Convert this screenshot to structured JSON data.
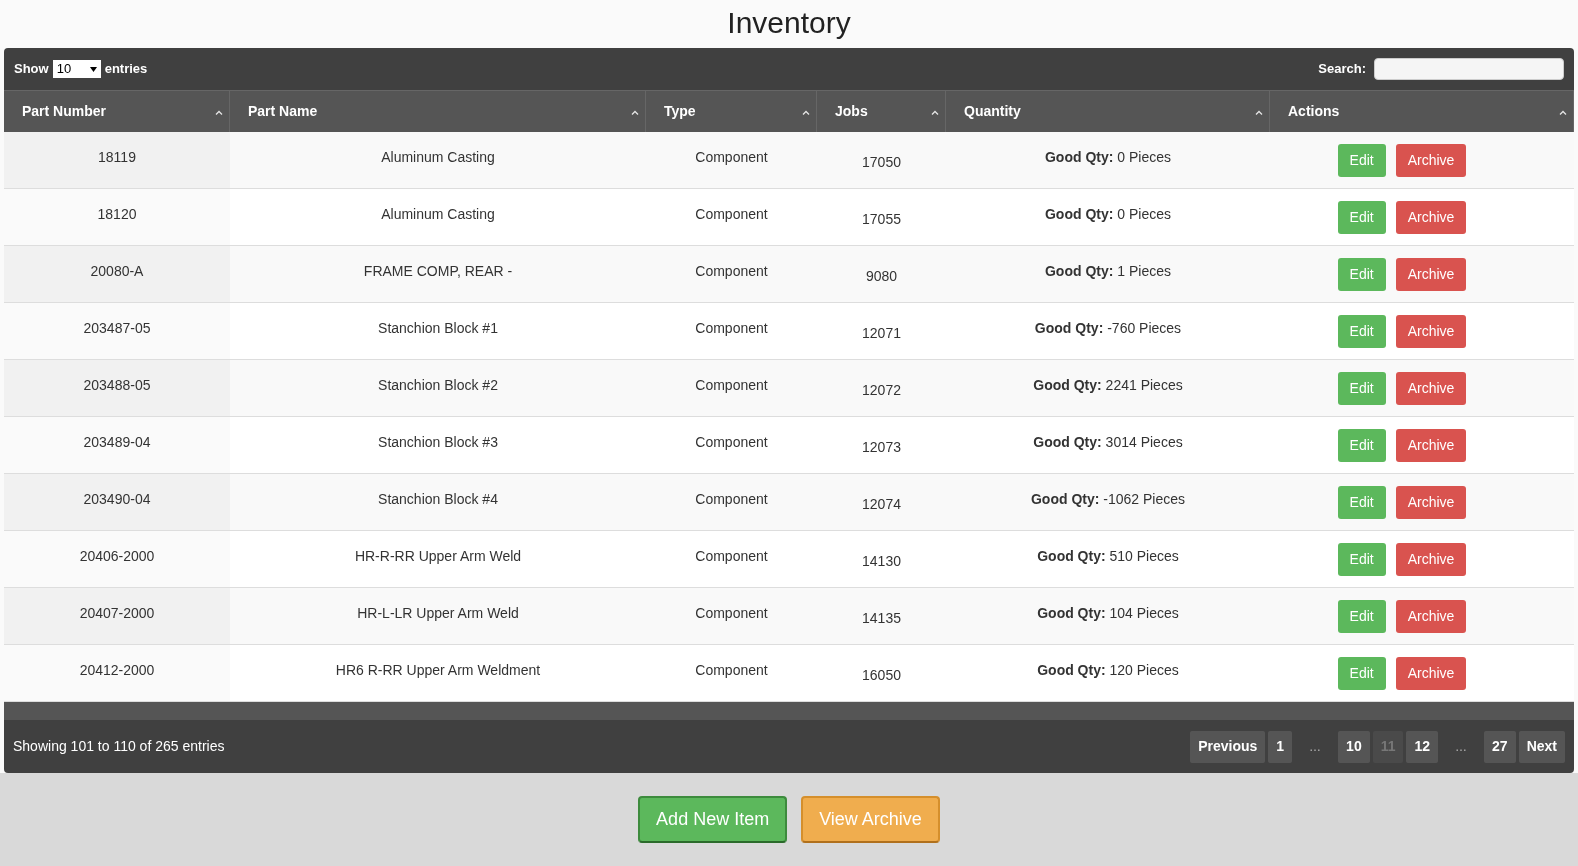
{
  "title": "Inventory",
  "length_menu": {
    "label_before": "Show",
    "value": "10",
    "label_after": "entries"
  },
  "search": {
    "label": "Search:"
  },
  "columns": [
    "Part Number",
    "Part Name",
    "Type",
    "Jobs",
    "Quantity",
    "Actions"
  ],
  "rows": [
    {
      "part_number": "18119",
      "part_name": "Aluminum Casting",
      "type": "Component",
      "jobs": "17050",
      "quantity": "**Good Qty:** 0 Pieces",
      "actions": [
        "Edit",
        "Archive"
      ]
    },
    {
      "part_number": "18120",
      "part_name": "Aluminum Casting",
      "type": "Component",
      "jobs": "17055",
      "quantity": "**Good Qty:** 0 Pieces",
      "actions": [
        "Edit",
        "Archive"
      ]
    },
    {
      "part_number": "20080-A",
      "part_name": "FRAME COMP, REAR -",
      "type": "Component",
      "jobs": "9080",
      "quantity": "**Good Qty:** 1 Pieces",
      "actions": [
        "Edit",
        "Archive"
      ]
    },
    {
      "part_number": "203487-05",
      "part_name": "Stanchion Block #1",
      "type": "Component",
      "jobs": "12071",
      "quantity": "**Good Qty:** -760 Pieces",
      "actions": [
        "Edit",
        "Archive"
      ]
    },
    {
      "part_number": "203488-05",
      "part_name": "Stanchion Block #2",
      "type": "Component",
      "jobs": "12072",
      "quantity": "**Good Qty:** 2241 Pieces",
      "actions": [
        "Edit",
        "Archive"
      ]
    },
    {
      "part_number": "203489-04",
      "part_name": "Stanchion Block #3",
      "type": "Component",
      "jobs": "12073",
      "quantity": "**Good Qty:** 3014 Pieces",
      "actions": [
        "Edit",
        "Archive"
      ]
    },
    {
      "part_number": "203490-04",
      "part_name": "Stanchion Block #4",
      "type": "Component",
      "jobs": "12074",
      "quantity": "**Good Qty:** -1062 Pieces",
      "actions": [
        "Edit",
        "Archive"
      ]
    },
    {
      "part_number": "20406-2000",
      "part_name": "HR-R-RR Upper Arm Weld",
      "type": "Component",
      "jobs": "14130",
      "quantity": "**Good Qty:** 510 Pieces",
      "actions": [
        "Edit",
        "Archive"
      ]
    },
    {
      "part_number": "20407-2000",
      "part_name": "HR-L-LR Upper Arm Weld",
      "type": "Component",
      "jobs": "14135",
      "quantity": "**Good Qty:** 104 Pieces",
      "actions": [
        "Edit",
        "Archive"
      ]
    },
    {
      "part_number": "20412-2000",
      "part_name": "HR6 R-RR Upper Arm Weldment",
      "type": "Component",
      "jobs": "16050",
      "quantity": "**Good Qty:** 120 Pieces",
      "actions": [
        "Edit",
        "Archive"
      ]
    }
  ],
  "info": "Showing 101 to 110 of 265 entries",
  "pagination": [
    {
      "kind": "button",
      "label": "Previous",
      "selected": false
    },
    {
      "kind": "button",
      "label": "1",
      "selected": false
    },
    {
      "kind": "ellipsis",
      "label": "…"
    },
    {
      "kind": "button",
      "label": "10",
      "selected": false
    },
    {
      "kind": "button",
      "label": "11",
      "selected": true
    },
    {
      "kind": "button",
      "label": "12",
      "selected": false
    },
    {
      "kind": "ellipsis",
      "label": "…"
    },
    {
      "kind": "button",
      "label": "27",
      "selected": false
    },
    {
      "kind": "button",
      "label": "Next",
      "selected": false
    }
  ],
  "bottom_buttons": [
    {
      "kind": "success",
      "label": "Add New Item"
    },
    {
      "kind": "warning",
      "label": "View Archive"
    }
  ]
}
